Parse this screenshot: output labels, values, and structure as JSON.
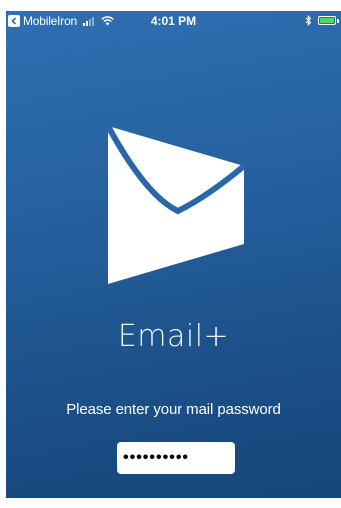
{
  "status_bar": {
    "back_app_label": "MobileIron",
    "time": "4:01 PM",
    "signal_bars_filled": 2,
    "signal_bars_total": 4,
    "battery_level": 1.0,
    "battery_color": "#4cd964",
    "icons": [
      "back-arrow-icon",
      "signal-icon",
      "wifi-icon",
      "bluetooth-icon",
      "battery-icon"
    ]
  },
  "app": {
    "logo_icon": "envelope-icon",
    "name": "Email+"
  },
  "login": {
    "prompt": "Please enter your mail password",
    "password_value": "••••••••••"
  },
  "colors": {
    "background_top": "#2f6fb2",
    "background_bottom": "#16467a",
    "envelope_fill": "#ffffff"
  }
}
